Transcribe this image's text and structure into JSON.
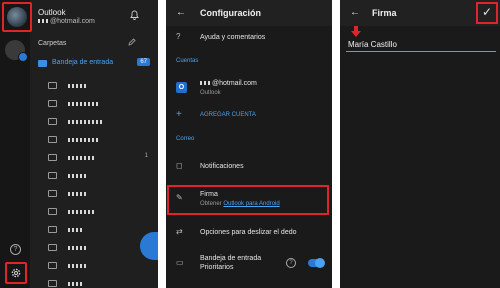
{
  "drawer": {
    "app_name": "Outlook",
    "email_suffix": "@hotmail.com",
    "folders_label": "Carpetas",
    "inbox": {
      "label": "Bandeja de entrada",
      "count": "67"
    },
    "folder_count": "1",
    "folders": [
      {
        "w": 20
      },
      {
        "w": 30
      },
      {
        "w": 34
      },
      {
        "w": 30
      },
      {
        "w": 26
      },
      {
        "w": 18
      },
      {
        "w": 18
      },
      {
        "w": 26
      },
      {
        "w": 16
      },
      {
        "w": 18
      },
      {
        "w": 18
      },
      {
        "w": 14
      }
    ]
  },
  "settings": {
    "title": "Configuración",
    "help": "Ayuda y comentarios",
    "section_accounts": "Cuentas",
    "account_email_suffix": "@hotmail.com",
    "account_type": "Outlook",
    "add_account": "AGREGAR CUENTA",
    "section_mail": "Correo",
    "notifications": "Notificaciones",
    "signature": "Firma",
    "signature_sub_prefix": "Obtener ",
    "signature_sub_link": "Outlook para Android",
    "swipe": "Opciones para deslizar el dedo",
    "focused_inbox_line1": "Bandeja de entrada",
    "focused_inbox_line2": "Prioritarios"
  },
  "signature_screen": {
    "title": "Firma",
    "value": "María Castillo"
  },
  "colors": {
    "accent": "#4aa3f0",
    "highlight": "#e0242c",
    "background": "#1a1a1a"
  }
}
